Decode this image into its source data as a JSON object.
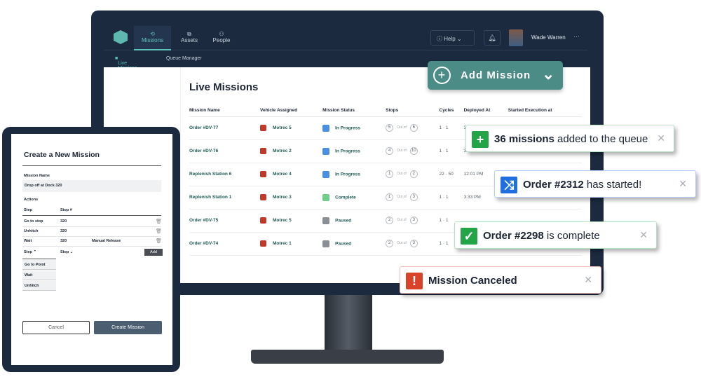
{
  "nav": {
    "tabs": [
      {
        "label": "Missions",
        "icon": "missions-icon"
      },
      {
        "label": "Assets",
        "icon": "assets-icon"
      },
      {
        "label": "People",
        "icon": "people-icon"
      }
    ],
    "help": "Help",
    "user": "Wade Warren"
  },
  "subnav": {
    "items": [
      "Live Missions",
      "Queue Manager"
    ]
  },
  "page": {
    "title": "Live Missions",
    "add_button": "Add Mission"
  },
  "table": {
    "headers": [
      "Mission Name",
      "Vehicle Assigned",
      "Mission Status",
      "Stops",
      "Cycles",
      "Deployed At",
      "Started Execution at"
    ],
    "out_of": "Out of",
    "rows": [
      {
        "name": "Order #DV-77",
        "vehicle": "Motrec 5",
        "status": "In Progress",
        "stop": "5",
        "total": "6",
        "cycles": "1 · 1",
        "deployed": "3:32 PM"
      },
      {
        "name": "Order #DV-76",
        "vehicle": "Motrec 2",
        "status": "In Progress",
        "stop": "4",
        "total": "10",
        "cycles": "1 · 1",
        "deployed": "3:36 PM"
      },
      {
        "name": "Replenish Station 6",
        "vehicle": "Motrec 4",
        "status": "In Progress",
        "stop": "1",
        "total": "2",
        "cycles": "22 · 50",
        "deployed": "12:01 PM"
      },
      {
        "name": "Replenish Station 1",
        "vehicle": "Motrec 3",
        "status": "Complete",
        "stop": "1",
        "total": "3",
        "cycles": "1 · 1",
        "deployed": "3:33 PM"
      },
      {
        "name": "Order #DV-75",
        "vehicle": "Motrec 5",
        "status": "Paused",
        "stop": "2",
        "total": "3",
        "cycles": "1 · 1",
        "deployed": ""
      },
      {
        "name": "Order #DV-74",
        "vehicle": "Motrec 1",
        "status": "Paused",
        "stop": "2",
        "total": "3",
        "cycles": "1 · 1",
        "deployed": ""
      }
    ]
  },
  "status_colors": {
    "In Progress": "#4a8fe0",
    "Complete": "#6fcf8a",
    "Paused": "#8a8f96"
  },
  "tablet": {
    "title": "Create a New Mission",
    "mission_name_label": "Mission Name",
    "mission_name_value": "Drop off at Dock 320",
    "actions_label": "Actions",
    "step_header": "Step",
    "stop_header": "Stop #",
    "actions": [
      {
        "step": "Go to stop",
        "stop": "320",
        "extra": ""
      },
      {
        "step": "Unhitch",
        "stop": "320",
        "extra": ""
      },
      {
        "step": "Wait",
        "stop": "320",
        "extra": "Manual Release"
      }
    ],
    "step_select": "Step",
    "stop_select": "Stop",
    "add": "Add",
    "options": [
      "Go to Point",
      "Wait",
      "Unhitch"
    ],
    "cancel": "Cancel",
    "create": "Create Mission"
  },
  "toasts": [
    {
      "bold": "36 missions",
      "rest": " added to the queue",
      "color": "#22a447",
      "icon": "plus-icon"
    },
    {
      "bold": "Order #2312",
      "rest": " has started!",
      "color": "#1f6fe0",
      "icon": "shuffle-icon"
    },
    {
      "bold": "Order #2298",
      "rest": " is complete",
      "color": "#22a447",
      "icon": "check-icon"
    },
    {
      "bold": "Mission Canceled",
      "rest": "",
      "color": "#d8432a",
      "icon": "alert-icon"
    }
  ]
}
